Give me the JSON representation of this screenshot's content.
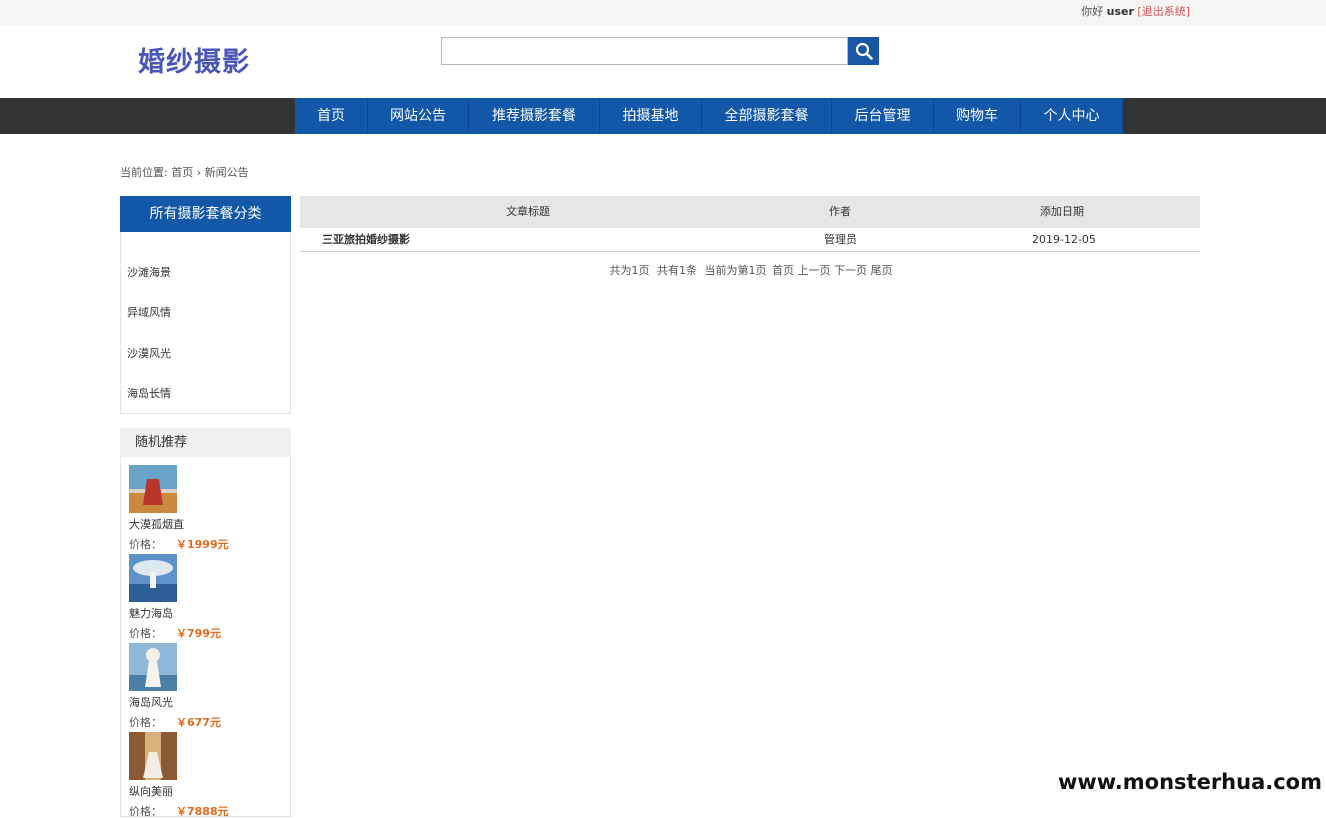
{
  "topbar": {
    "greeting": "你好",
    "username": "user",
    "logout": "[退出系统]"
  },
  "logo": "婚纱摄影",
  "search": {
    "placeholder": ""
  },
  "nav": [
    "首页",
    "网站公告",
    "推荐摄影套餐",
    "拍摄基地",
    "全部摄影套餐",
    "后台管理",
    "购物车",
    "个人中心"
  ],
  "breadcrumb": {
    "prefix": "当前位置:",
    "home": "首页",
    "current": "新闻公告"
  },
  "categories": {
    "title": "所有摄影套餐分类",
    "items": [
      "沙滩海景",
      "异域风情",
      "沙漠风光",
      "海岛长情"
    ]
  },
  "recommend": {
    "title": "随机推荐",
    "price_label": "价格：",
    "items": [
      {
        "name": "大漠孤烟直",
        "price": "￥1999元"
      },
      {
        "name": "魅力海岛",
        "price": "￥799元"
      },
      {
        "name": "海岛风光",
        "price": "￥677元"
      },
      {
        "name": "纵向美丽",
        "price": "￥7888元"
      }
    ]
  },
  "table": {
    "headers": [
      "文章标题",
      "作者",
      "添加日期"
    ],
    "rows": [
      {
        "title": "三亚旅拍婚纱摄影",
        "author": "管理员",
        "date": "2019-12-05"
      }
    ]
  },
  "pager": {
    "total_pages": "共为1页",
    "total_items": "共有1条",
    "current": "当前为第1页",
    "first": "首页",
    "prev": "上一页",
    "next": "下一页",
    "last": "尾页"
  },
  "watermark": "www.monsterhua.com",
  "colors": {
    "nav_blue": "#1257a8",
    "price_orange": "#e36b1b",
    "dark_bar": "#333333"
  }
}
